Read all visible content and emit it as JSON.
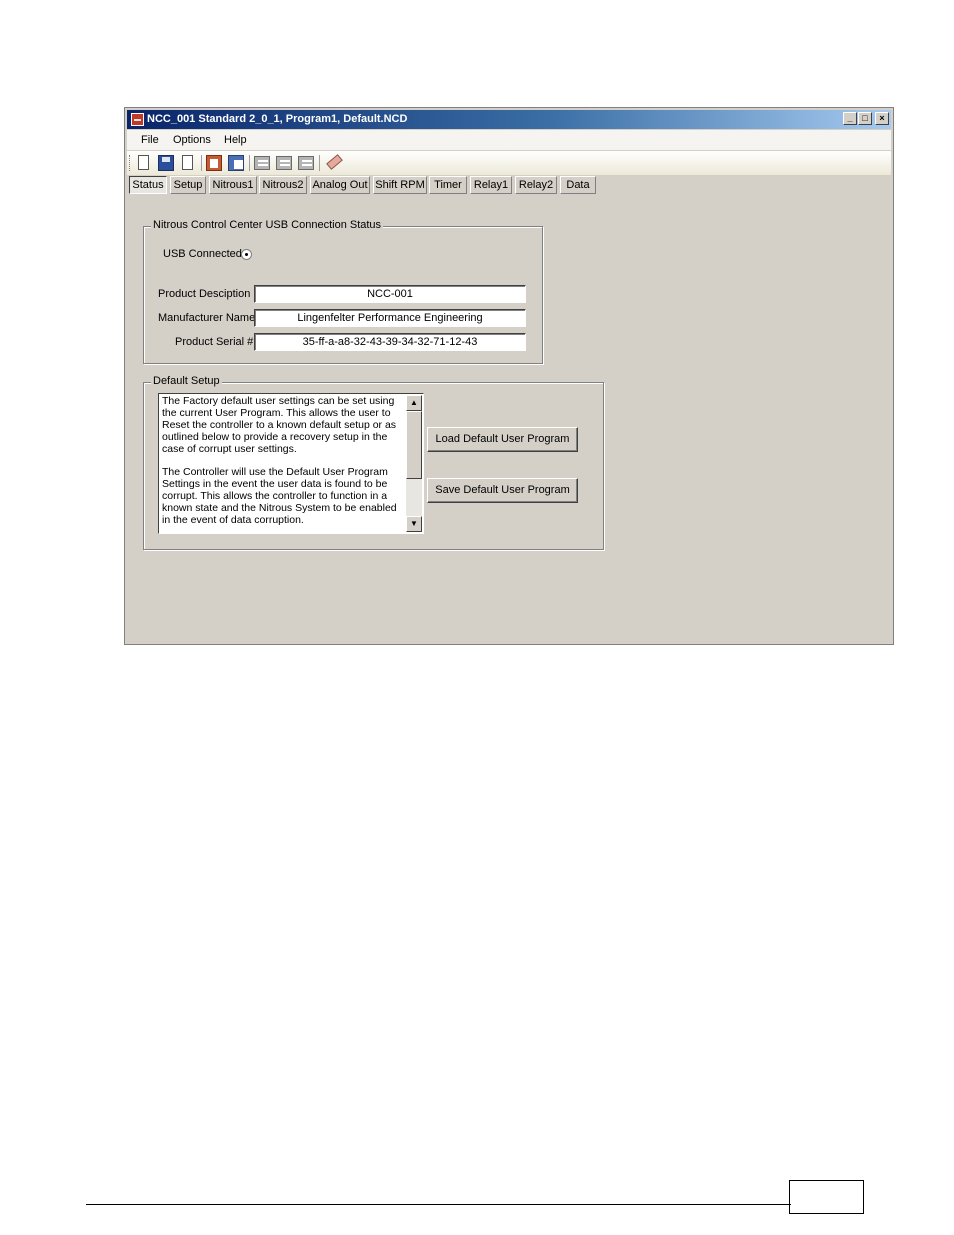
{
  "window": {
    "title": "NCC_001 Standard 2_0_1, Program1, Default.NCD",
    "controls": {
      "minimize": "_",
      "maximize": "□",
      "close": "×"
    }
  },
  "menu": [
    "File",
    "Options",
    "Help"
  ],
  "toolbar": {
    "icons": [
      "new-icon",
      "save-icon",
      "open-icon",
      "read-icon",
      "write-icon",
      "program-1-icon",
      "program-2-icon",
      "program-3-icon",
      "eraser-icon"
    ]
  },
  "tabs": [
    "Status",
    "Setup",
    "Nitrous1",
    "Nitrous2",
    "Analog Out",
    "Shift RPM",
    "Timer",
    "Relay1",
    "Relay2",
    "Data"
  ],
  "active_tab": "Status",
  "usb_status": {
    "group_title": "Nitrous Control Center USB Connection Status",
    "usb_connected_label": "USB Connected",
    "usb_connected": true,
    "product_description_label": "Product Desciption",
    "product_description": "NCC-001",
    "manufacturer_name_label": "Manufacturer Name",
    "manufacturer_name": "Lingenfelter Performance Engineering",
    "serial_label": "Product Serial #",
    "serial": "35-ff-a-a8-32-43-39-34-32-71-12-43"
  },
  "default_setup": {
    "group_title": "Default Setup",
    "description": "The Factory default user settings can be set using the current User Program. This allows the user to Reset the controller to a known default setup or as outlined below to provide a recovery setup in the case of corrupt user settings.\n\nThe Controller will use the Default User Program Settings in the event the user data is found to be corrupt. This allows the controller to function in a known state and the Nitrous System to be enabled in the event of data corruption.",
    "load_button": "Load Default User Program",
    "save_button": "Save Default User Program"
  },
  "scroll": {
    "up": "▲",
    "down": "▼"
  }
}
